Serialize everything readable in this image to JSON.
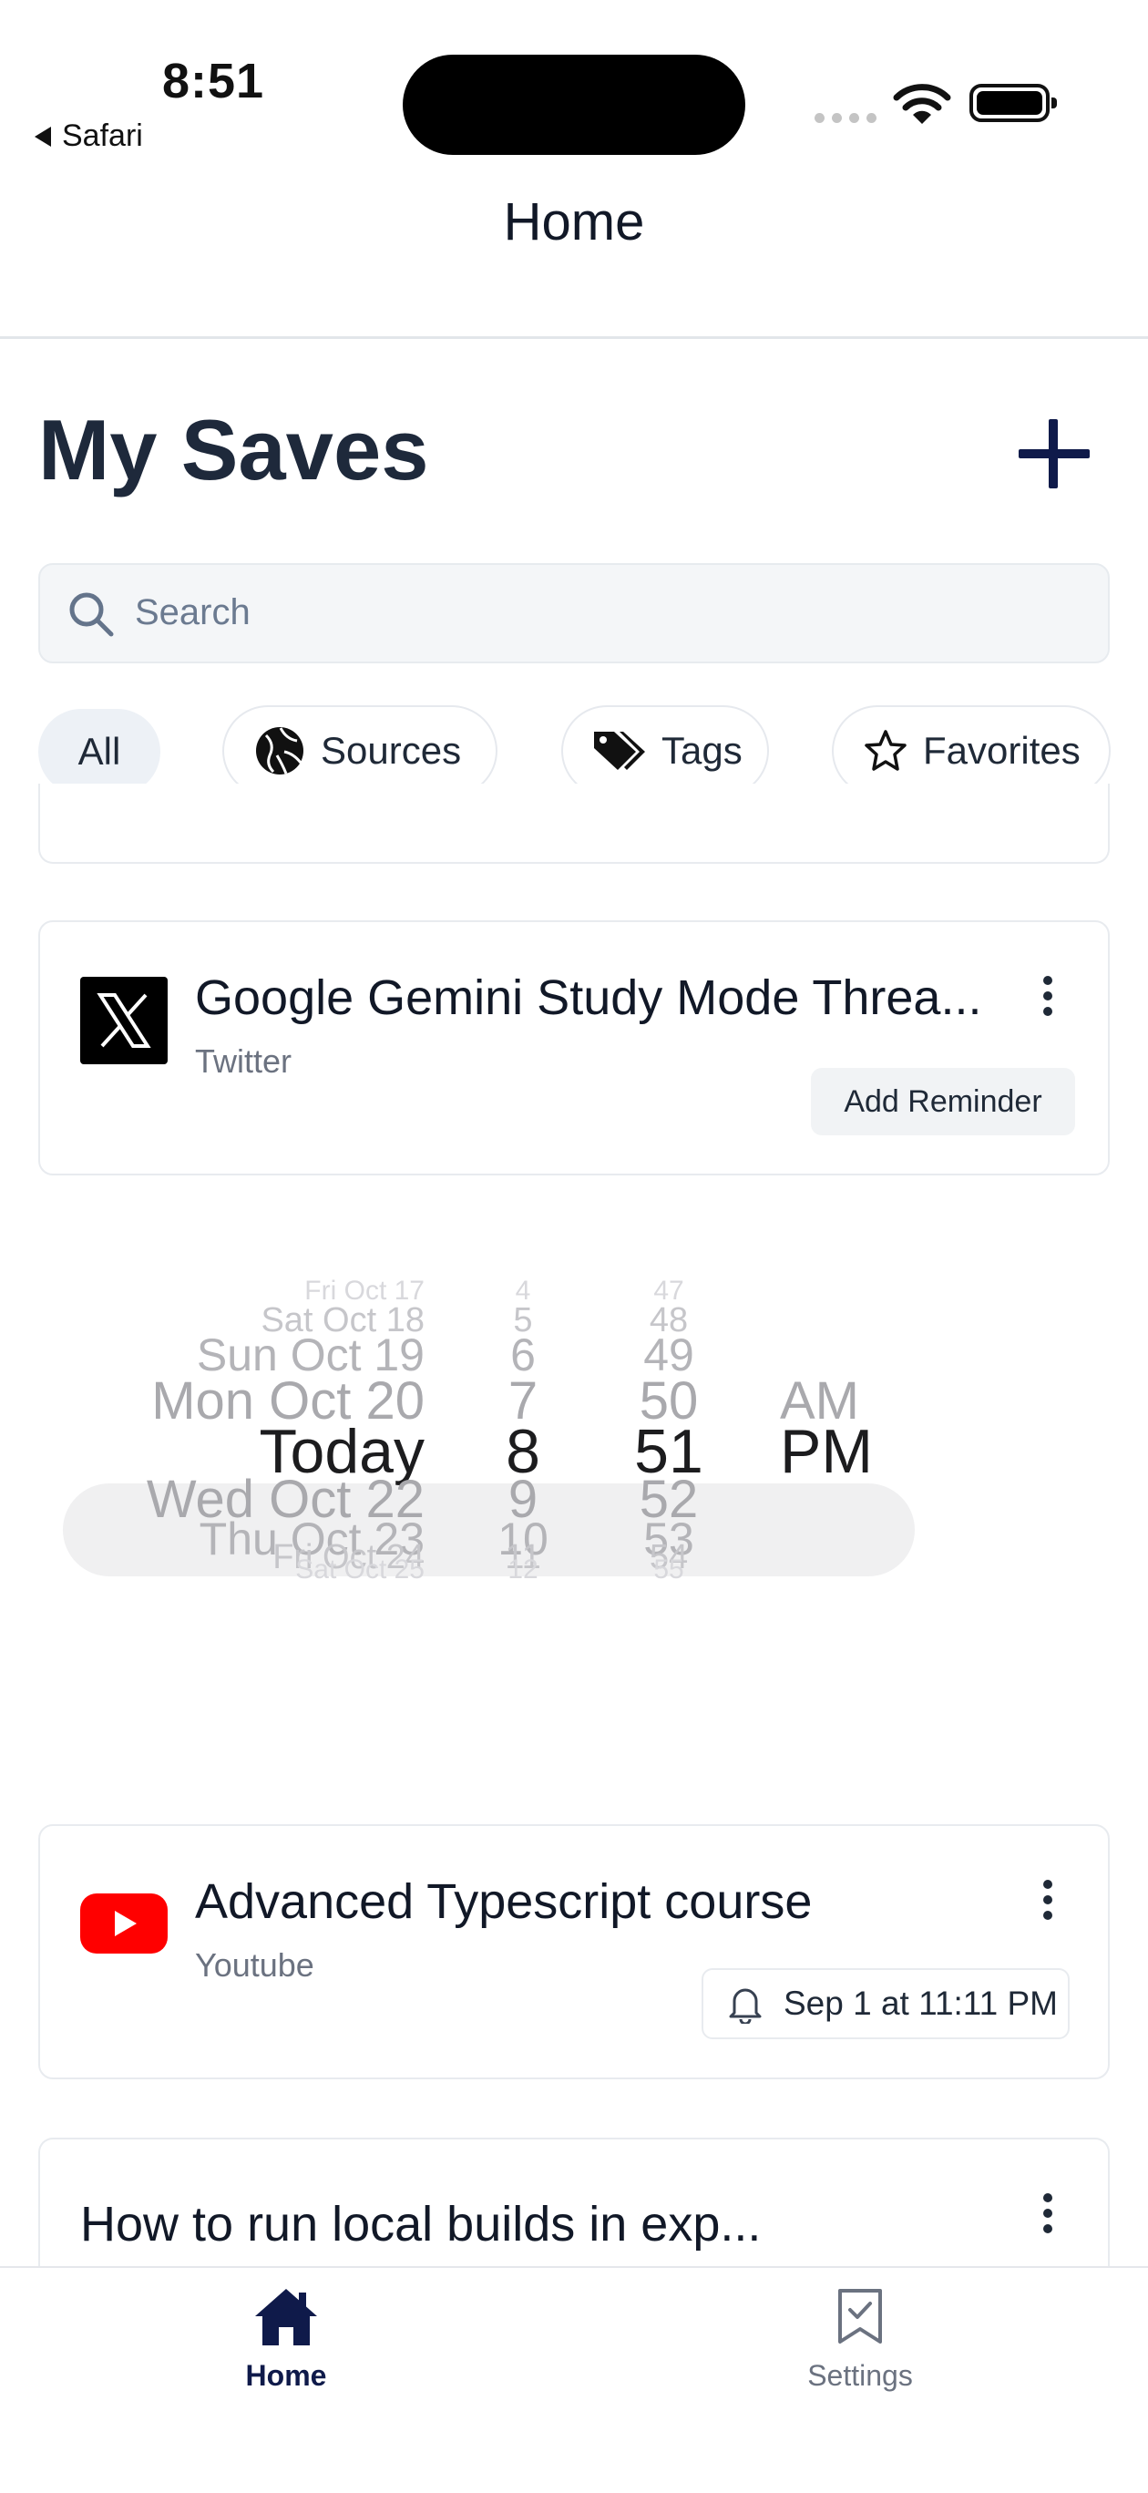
{
  "status_bar": {
    "time": "8:51",
    "back_app": "Safari"
  },
  "header": {
    "title": "Home"
  },
  "page": {
    "title": "My Saves"
  },
  "search": {
    "placeholder": "Search"
  },
  "filters": {
    "all": "All",
    "sources": "Sources",
    "tags": "Tags",
    "favorites": "Favorites"
  },
  "saves": [
    {
      "title": "Google Gemini Study Mode Threa...",
      "source": "Twitter",
      "icon": "x-logo-icon",
      "reminder_button": "Add Reminder"
    },
    {
      "title": "Advanced Typescript course",
      "source": "Youtube",
      "icon": "youtube-logo-icon",
      "reminder": "Sep 1 at 11:11 PM"
    },
    {
      "title": "How to run local builds in exp..."
    }
  ],
  "date_picker": {
    "dates": [
      "Fri Oct 17",
      "Sat Oct 18",
      "Sun Oct 19",
      "Mon Oct 20",
      "Today",
      "Wed Oct 22",
      "Thu Oct 23",
      "Fri Oct 24",
      "Sat Oct 25"
    ],
    "hours": [
      "4",
      "5",
      "6",
      "7",
      "8",
      "9",
      "10",
      "11",
      "12"
    ],
    "minutes": [
      "47",
      "48",
      "49",
      "50",
      "51",
      "52",
      "53",
      "54",
      "55"
    ],
    "meridiem": [
      "AM",
      "PM"
    ],
    "selected": {
      "date": "Today",
      "hour": "8",
      "minute": "51",
      "meridiem": "PM"
    }
  },
  "tabs": [
    {
      "label": "Home",
      "icon": "house-icon",
      "active": true
    },
    {
      "label": "Settings",
      "icon": "bookmark-check-icon",
      "active": false
    }
  ],
  "colors": {
    "accent": "#0f1a4a",
    "youtube": "#ff0000",
    "muted": "#6b7280"
  }
}
